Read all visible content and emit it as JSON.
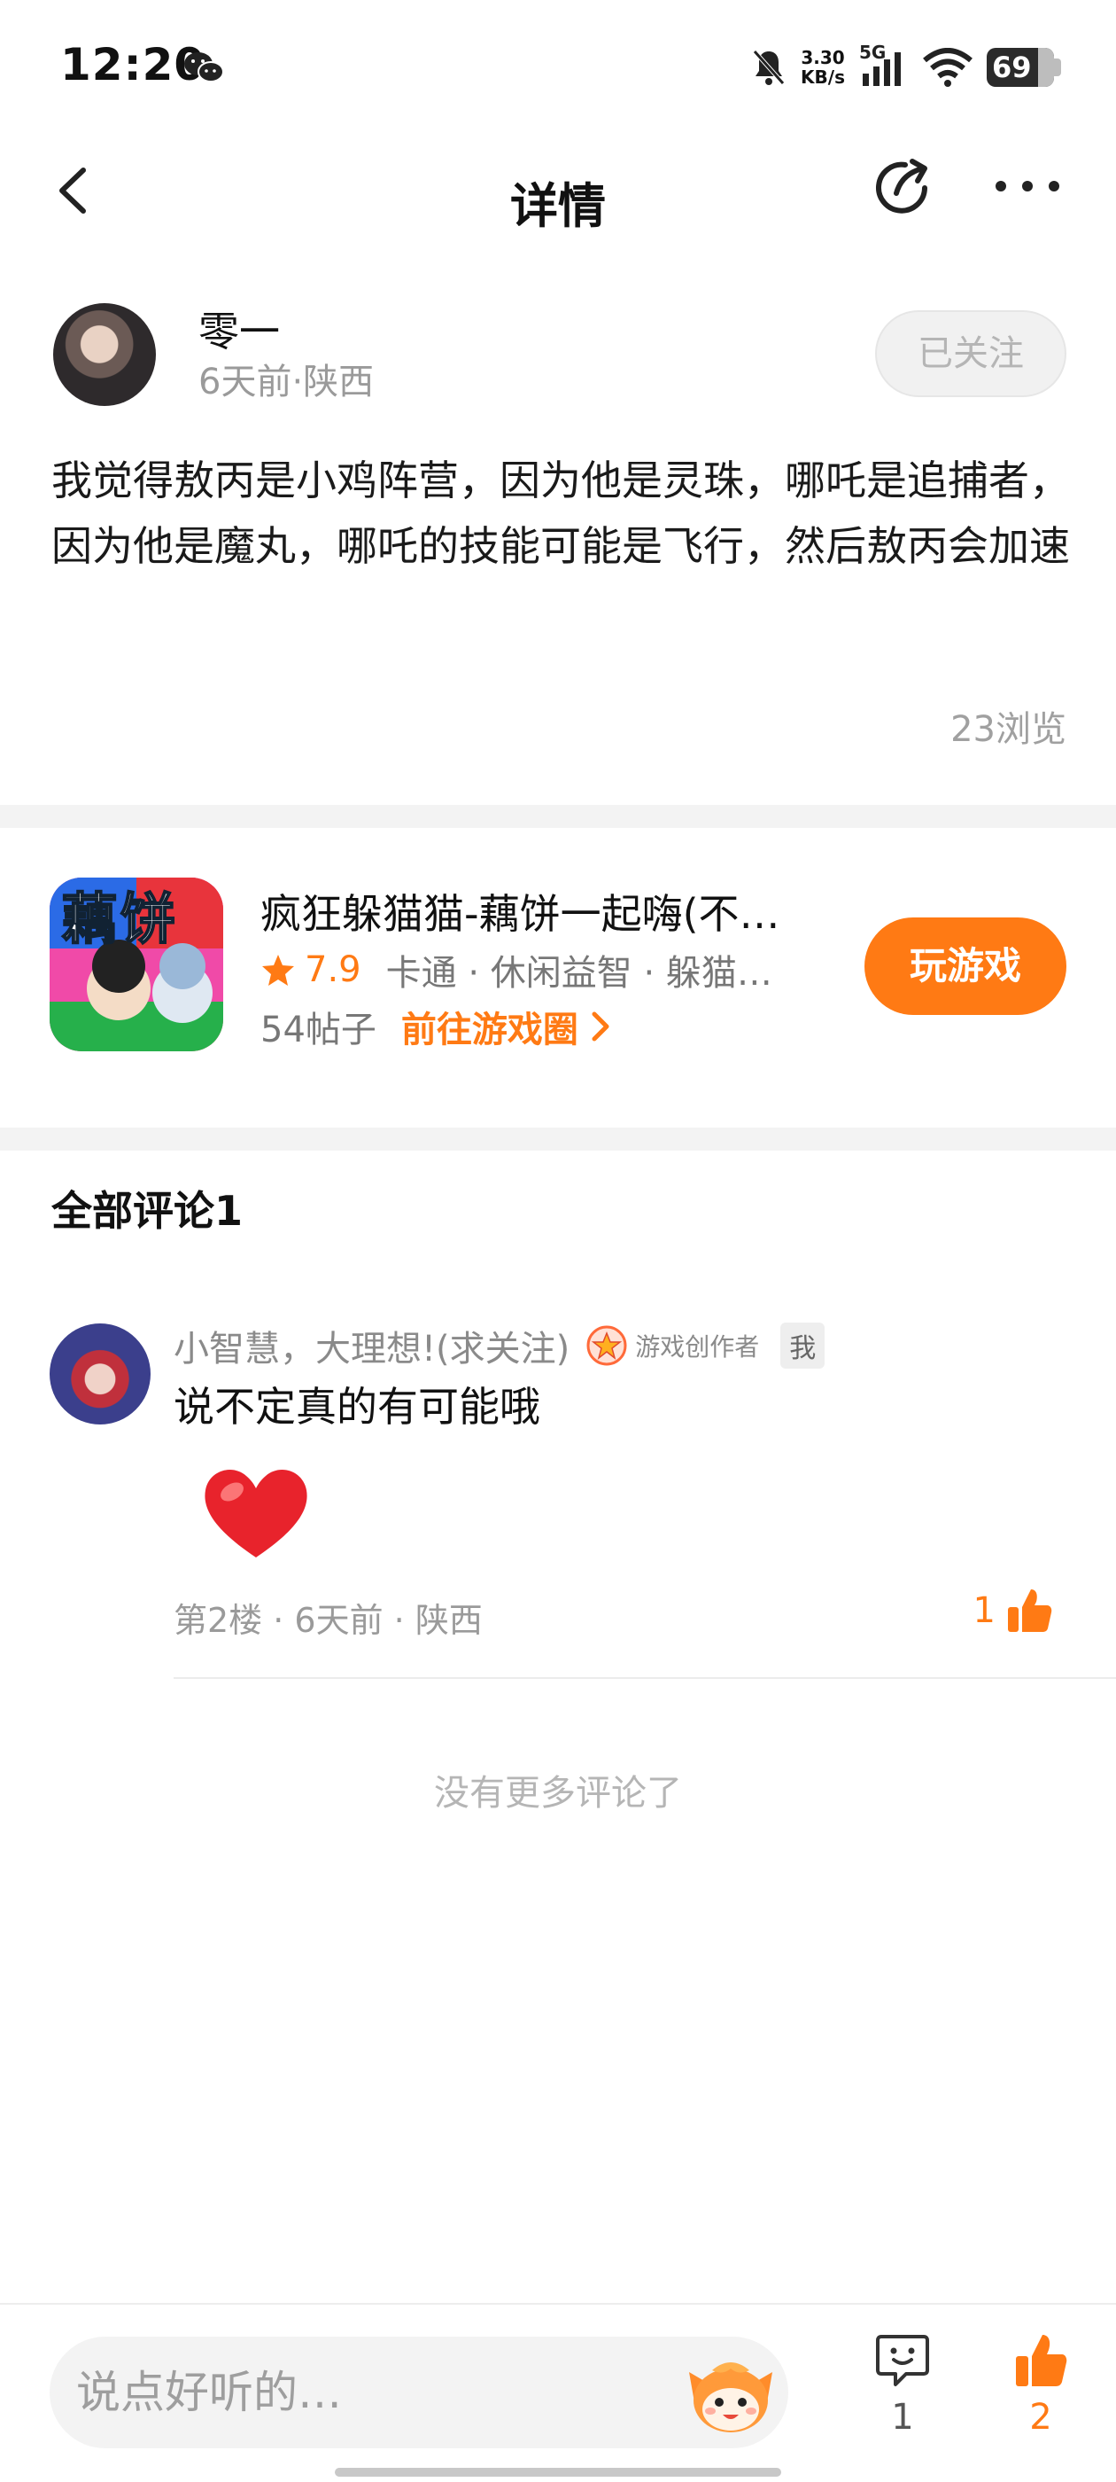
{
  "status_bar": {
    "time": "12:20",
    "net_speed_value": "3.30",
    "net_speed_unit": "KB/s",
    "network": "5G",
    "battery": "69"
  },
  "header": {
    "title": "详情"
  },
  "post": {
    "author_name": "零一",
    "author_meta": "6天前·陕西",
    "follow_label": "已关注",
    "content": "我觉得敖丙是小鸡阵营，因为他是灵珠，哪吒是追捕者，因为他是魔丸，哪吒的技能可能是飞行，然后敖丙会加速",
    "views": "23浏览"
  },
  "game": {
    "title": "疯狂躲猫猫-藕饼一起嗨(不…",
    "rating": "7.9",
    "tags": "卡通 · 休闲益智 · 躲猫…",
    "posts": "54帖子",
    "goto_label": "前往游戏圈",
    "play_label": "玩游戏",
    "icon_text": "藕饼"
  },
  "comments": {
    "title": "全部评论1",
    "items": [
      {
        "name": "小智慧，大理想!(求关注)",
        "creator_tag": "游戏创作者",
        "me_tag": "我",
        "text": "说不定真的有可能哦",
        "meta": "第2楼 · 6天前 · 陕西",
        "likes": "1"
      }
    ],
    "no_more": "没有更多评论了"
  },
  "bottom_bar": {
    "input_placeholder": "说点好听的…",
    "comment_count": "1",
    "like_count": "2"
  },
  "colors": {
    "accent": "#ff7a14",
    "divider": "#f3f3f3"
  }
}
